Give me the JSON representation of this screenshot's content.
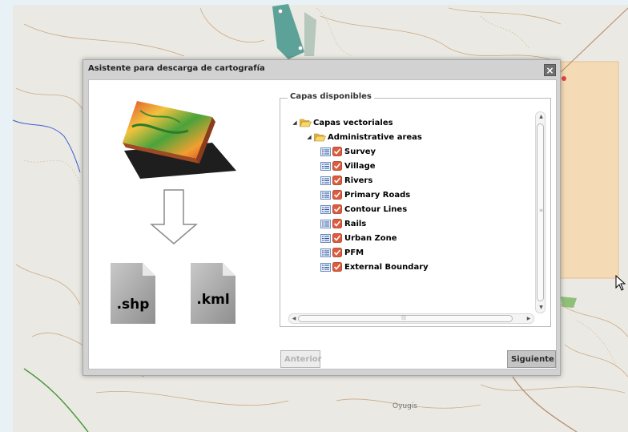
{
  "map": {
    "place_label": "Oyugis"
  },
  "dialog": {
    "title": "Asistente para descarga de cartografía",
    "close_icon": "close-icon",
    "formats": [
      ".shp",
      ".kml"
    ],
    "panel": {
      "legend": "Capas disponibles",
      "root_label": "Capas vectoriales",
      "group_label": "Administrative areas",
      "layers": [
        {
          "label": "Survey",
          "checked": true
        },
        {
          "label": "Village",
          "checked": true
        },
        {
          "label": "Rivers",
          "checked": true
        },
        {
          "label": "Primary Roads",
          "checked": true
        },
        {
          "label": "Contour Lines",
          "checked": true
        },
        {
          "label": "Rails",
          "checked": true
        },
        {
          "label": "Urban Zone",
          "checked": true
        },
        {
          "label": "PFM",
          "checked": true
        },
        {
          "label": "External Boundary",
          "checked": true
        }
      ]
    },
    "buttons": {
      "prev": "Anterior",
      "next": "Siguiente",
      "prev_enabled": false
    }
  },
  "colors": {
    "checkbox": "#e05a3c",
    "folder": "#f2cc4f",
    "orange_zone": "#f7d7a8",
    "teal_zone": "#4e9a8f"
  }
}
